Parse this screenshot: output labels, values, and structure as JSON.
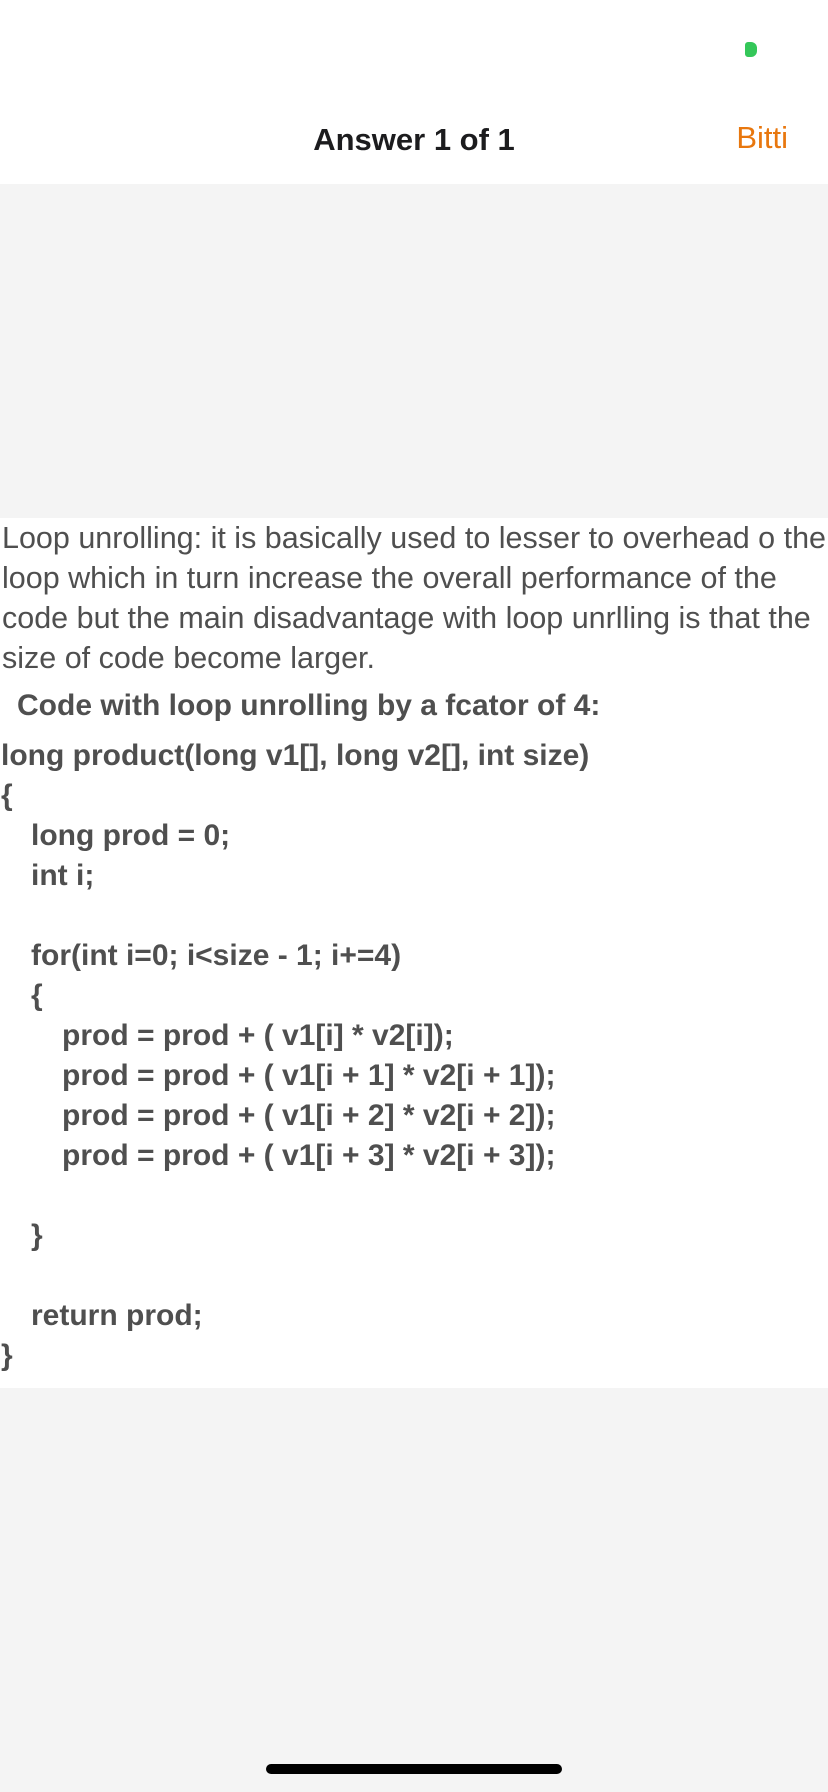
{
  "header": {
    "title": "Answer 1 of 1",
    "done_label": "Bitti"
  },
  "answer": {
    "explanation": "Loop unrolling: it is basically used to lesser to overhead o the loop which in turn increase the overall performance of the code but the main disadvantage with loop unrlling is that the size of code become larger.",
    "code_heading": "Code with loop unrolling by a fcator of 4:",
    "code_lines": {
      "l0": "long product(long v1[], long v2[], int size)",
      "l1": "{",
      "l2": "long prod = 0;",
      "l3": "int i;",
      "l4": "",
      "l5": "for(int i=0; i<size - 1; i+=4)",
      "l6": "{",
      "l7": "prod = prod + ( v1[i] * v2[i]);",
      "l8": "prod = prod + ( v1[i + 1] * v2[i + 1]);",
      "l9": "prod = prod + ( v1[i + 2] * v2[i + 2]);",
      "l10": "prod = prod + ( v1[i + 3] * v2[i + 3]);",
      "l11": "",
      "l12": "}",
      "l13": "",
      "l14": "return prod;",
      "l15": "}"
    }
  },
  "colors": {
    "accent": "#e8770e",
    "status_green": "#34c759",
    "gray_background": "#f4f4f4"
  }
}
